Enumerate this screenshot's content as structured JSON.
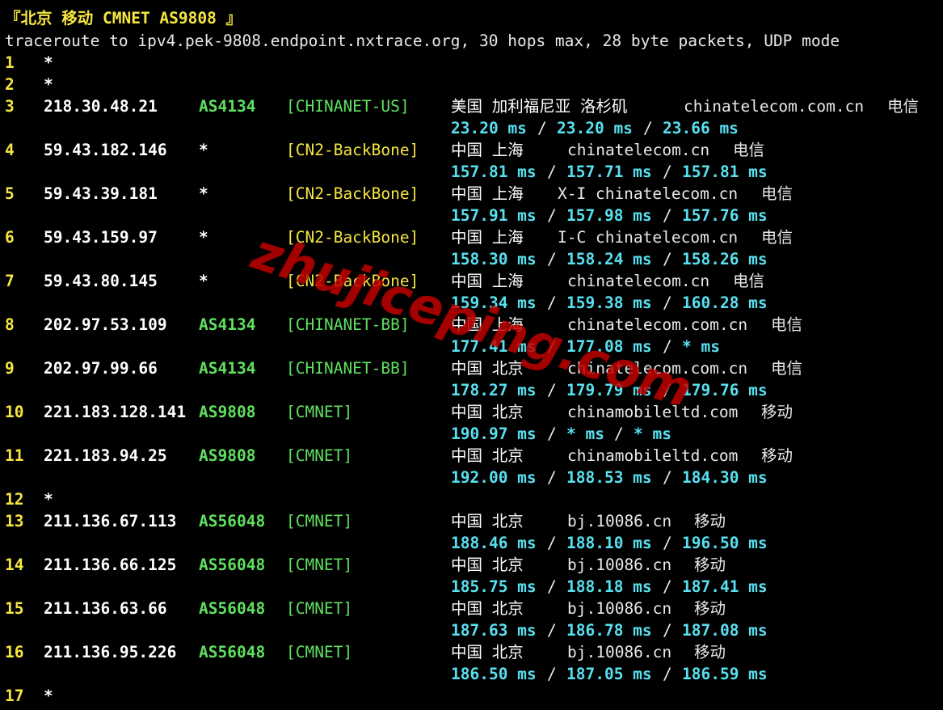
{
  "header": {
    "title": "『北京 移动 CMNET AS9808 』",
    "command": "traceroute to ipv4.pek-9808.endpoint.nxtrace.org, 30 hops max, 28 byte packets, UDP mode"
  },
  "watermark": {
    "text": "zhujiceping.com",
    "color": "#c00000"
  },
  "colors": {
    "background": "#000000",
    "hop": "#f5e642",
    "asn": "#5fe05f",
    "rtt": "#58e0f0",
    "ip": "#ffffff"
  },
  "hops": [
    {
      "n": "1",
      "star": "*"
    },
    {
      "n": "2",
      "star": "*"
    },
    {
      "n": "3",
      "ip": "218.30.48.21",
      "asn": "AS4134",
      "tag": "[CHINANET-US]",
      "tag_color": "green",
      "geo": "美国 加利福尼亚 洛杉矶",
      "host": "chinatelecom.com.cn",
      "isp": "电信",
      "rtt": [
        "23.20 ms",
        "23.20 ms",
        "23.66 ms"
      ]
    },
    {
      "n": "4",
      "ip": "59.43.182.146",
      "asn": "*",
      "tag": "[CN2-BackBone]",
      "tag_color": "yellow",
      "geo": "中国 上海",
      "host": "chinatelecom.cn",
      "isp": "电信",
      "rtt": [
        "157.81 ms",
        "157.71 ms",
        "157.81 ms"
      ]
    },
    {
      "n": "5",
      "ip": "59.43.39.181",
      "asn": "*",
      "tag": "[CN2-BackBone]",
      "tag_color": "yellow",
      "geo": "中国 上海",
      "host": "X-I chinatelecom.cn",
      "isp": "电信",
      "rtt": [
        "157.91 ms",
        "157.98 ms",
        "157.76 ms"
      ]
    },
    {
      "n": "6",
      "ip": "59.43.159.97",
      "asn": "*",
      "tag": "[CN2-BackBone]",
      "tag_color": "yellow",
      "geo": "中国 上海",
      "host": "I-C chinatelecom.cn",
      "isp": "电信",
      "rtt": [
        "158.30 ms",
        "158.24 ms",
        "158.26 ms"
      ]
    },
    {
      "n": "7",
      "ip": "59.43.80.145",
      "asn": "*",
      "tag": "[CN2-BackBone]",
      "tag_color": "yellow",
      "geo": "中国 上海",
      "host": "chinatelecom.cn",
      "isp": "电信",
      "rtt": [
        "159.34 ms",
        "159.38 ms",
        "160.28 ms"
      ]
    },
    {
      "n": "8",
      "ip": "202.97.53.109",
      "asn": "AS4134",
      "tag": "[CHINANET-BB]",
      "tag_color": "green",
      "geo": "中国 上海",
      "host": "chinatelecom.com.cn",
      "isp": "电信",
      "rtt": [
        "177.41 ms",
        "177.08 ms",
        "* ms"
      ]
    },
    {
      "n": "9",
      "ip": "202.97.99.66",
      "asn": "AS4134",
      "tag": "[CHINANET-BB]",
      "tag_color": "green",
      "geo": "中国 北京",
      "host": "chinatelecom.com.cn",
      "isp": "电信",
      "rtt": [
        "178.27 ms",
        "179.79 ms",
        "179.76 ms"
      ]
    },
    {
      "n": "10",
      "ip": "221.183.128.141",
      "asn": "AS9808",
      "tag": "[CMNET]",
      "tag_color": "green",
      "geo": "中国 北京",
      "host": "chinamobileltd.com",
      "isp": "移动",
      "rtt": [
        "190.97 ms",
        "* ms",
        "* ms"
      ]
    },
    {
      "n": "11",
      "ip": "221.183.94.25",
      "asn": "AS9808",
      "tag": "[CMNET]",
      "tag_color": "green",
      "geo": "中国 北京",
      "host": "chinamobileltd.com",
      "isp": "移动",
      "rtt": [
        "192.00 ms",
        "188.53 ms",
        "184.30 ms"
      ]
    },
    {
      "n": "12",
      "star": "*"
    },
    {
      "n": "13",
      "ip": "211.136.67.113",
      "asn": "AS56048",
      "tag": "[CMNET]",
      "tag_color": "green",
      "geo": "中国 北京",
      "host": "bj.10086.cn",
      "isp": "移动",
      "rtt": [
        "188.46 ms",
        "188.10 ms",
        "196.50 ms"
      ]
    },
    {
      "n": "14",
      "ip": "211.136.66.125",
      "asn": "AS56048",
      "tag": "[CMNET]",
      "tag_color": "green",
      "geo": "中国 北京",
      "host": "bj.10086.cn",
      "isp": "移动",
      "rtt": [
        "185.75 ms",
        "188.18 ms",
        "187.41 ms"
      ]
    },
    {
      "n": "15",
      "ip": "211.136.63.66",
      "asn": "AS56048",
      "tag": "[CMNET]",
      "tag_color": "green",
      "geo": "中国 北京",
      "host": "bj.10086.cn",
      "isp": "移动",
      "rtt": [
        "187.63 ms",
        "186.78 ms",
        "187.08 ms"
      ]
    },
    {
      "n": "16",
      "ip": "211.136.95.226",
      "asn": "AS56048",
      "tag": "[CMNET]",
      "tag_color": "green",
      "geo": "中国 北京",
      "host": "bj.10086.cn",
      "isp": "移动",
      "rtt": [
        "186.50 ms",
        "187.05 ms",
        "186.59 ms"
      ]
    },
    {
      "n": "17",
      "star": "*"
    }
  ]
}
